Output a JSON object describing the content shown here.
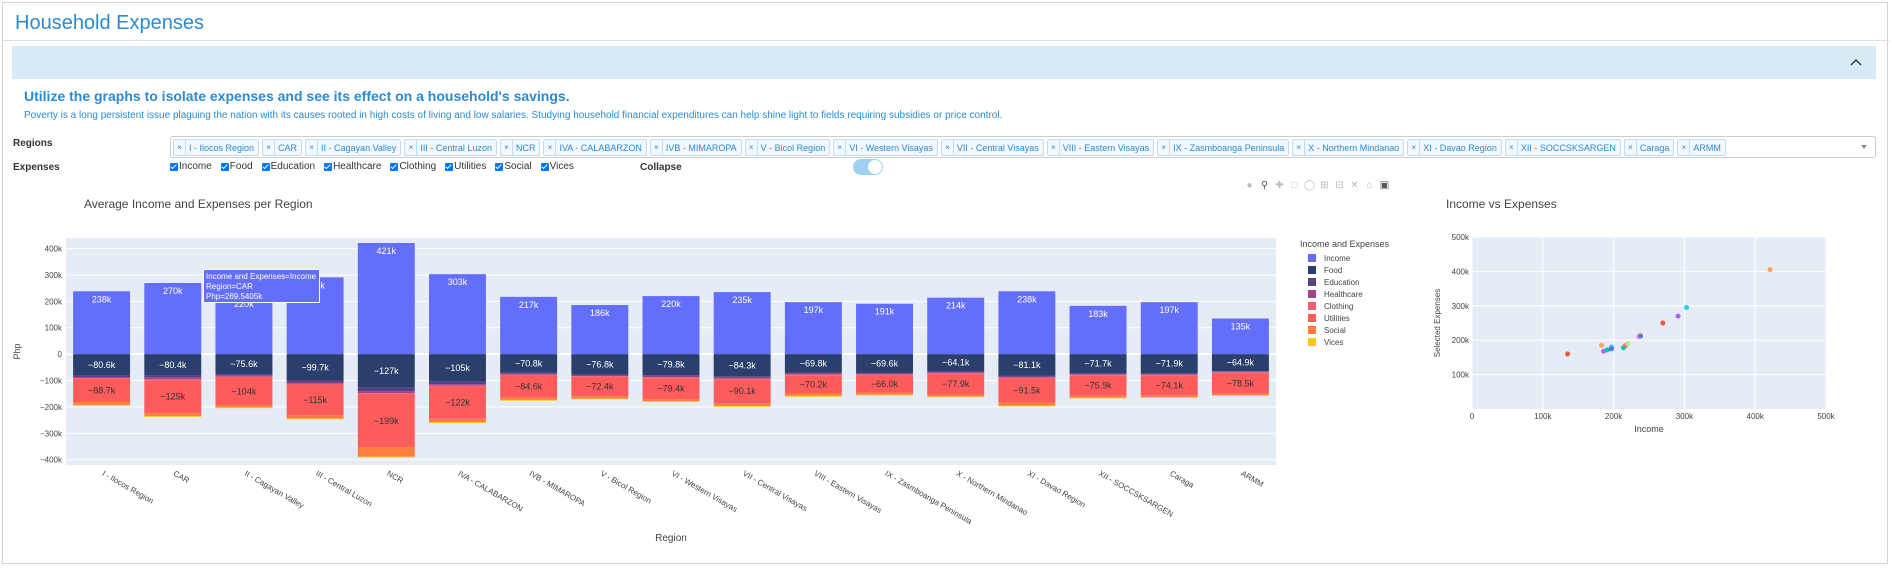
{
  "app": {
    "title": "Household Expenses"
  },
  "intro": {
    "heading": "Utilize the graphs to isolate expenses and see its effect on a household's savings.",
    "text": "Poverty is a long persistent issue plaguing the nation with its causes rooted in high costs of living and low salaries. Studying household financial expenditures can help shine light to fields requiring subsidies or price control."
  },
  "controls": {
    "regions_label": "Regions",
    "expenses_label": "Expenses",
    "collapse_label": "Collapse",
    "collapse_on": true,
    "regions": [
      "I - Ilocos Region",
      "CAR",
      "II - Cagayan Valley",
      "III - Central Luzon",
      "NCR",
      "IVA - CALABARZON",
      "IVB - MIMAROPA",
      "V - Bicol Region",
      "VI - Western Visayas",
      "VII - Central Visayas",
      "VIII - Eastern Visayas",
      "IX - Zasmboanga Peninsula",
      "X - Northern Mindanao",
      "XI - Davao Region",
      "XII - SOCCSKSARGEN",
      "Caraga",
      "ARMM"
    ],
    "remove_icon": "close-icon",
    "expenses": [
      {
        "label": "Income",
        "checked": true
      },
      {
        "label": "Food",
        "checked": true
      },
      {
        "label": "Education",
        "checked": true
      },
      {
        "label": "Healthcare",
        "checked": true
      },
      {
        "label": "Clothing",
        "checked": true
      },
      {
        "label": "Utilities",
        "checked": true
      },
      {
        "label": "Social",
        "checked": true
      },
      {
        "label": "Vices",
        "checked": true
      }
    ]
  },
  "modebar": [
    "camera-icon",
    "zoom-icon",
    "pan-icon",
    "box-select-icon",
    "lasso-icon",
    "zoom-in-icon",
    "zoom-out-icon",
    "autoscale-icon",
    "home-icon",
    "plotly-logo-icon"
  ],
  "colors": {
    "Income": "#636efa",
    "Food": "#2a3f6b",
    "Education": "#5b3f86",
    "Healthcare": "#a0458c",
    "Clothing": "#f25d76",
    "Utilities": "#fe5c5c",
    "Social": "#fd7f3c",
    "Vices": "#fdc21b"
  },
  "tooltip": {
    "line1": "Income and Expenses=Income",
    "line2": "Region=CAR",
    "line3": "Php=269.5405k"
  },
  "chart_data": [
    {
      "type": "bar",
      "title": "Average Income and Expenses per Region",
      "xlabel": "Region",
      "ylabel": "Php",
      "legend_title": "Income and Expenses",
      "legend_position": "right",
      "ylim": [
        -420000,
        440000
      ],
      "yticks": [
        400000,
        300000,
        200000,
        100000,
        0,
        -100000,
        -200000,
        -300000,
        -400000
      ],
      "ytick_labels": [
        "400k",
        "300k",
        "200k",
        "100k",
        "0",
        "−100k",
        "−200k",
        "−300k",
        "−400k"
      ],
      "categories": [
        "I - Ilocos Region",
        "CAR",
        "II - Cagayan Valley",
        "III - Central Luzon",
        "NCR",
        "IVA - CALABARZON",
        "IVB - MIMAROPA",
        "V - Bicol Region",
        "VI - Western Visayas",
        "VII - Central Visayas",
        "VIII - Eastern Visayas",
        "IX - Zasmboanga Peninsula",
        "X - Northern Mindanao",
        "XI - Davao Region",
        "XII - SOCCSKSARGEN",
        "Caraga",
        "ARMM"
      ],
      "series": [
        {
          "name": "Income",
          "values": [
            238000,
            269500,
            220000,
            291000,
            421000,
            303000,
            217000,
            186000,
            220000,
            235000,
            197000,
            191000,
            214000,
            238000,
            183000,
            197000,
            135000
          ],
          "labels": [
            "238k",
            "270k",
            "220k",
            "291k",
            "421k",
            "303k",
            "217k",
            "186k",
            "220k",
            "235k",
            "197k",
            "191k",
            "214k",
            "238k",
            "183k",
            "197k",
            "135k"
          ]
        },
        {
          "name": "Food",
          "values": [
            -80600,
            -80400,
            -75600,
            -99700,
            -127000,
            -105000,
            -70800,
            -76800,
            -79800,
            -84300,
            -69800,
            -69600,
            -64100,
            -81100,
            -71700,
            -71900,
            -64900
          ],
          "labels": [
            "−80.6k",
            "−80.4k",
            "−75.6k",
            "−99.7k",
            "−127k",
            "−105k",
            "−70.8k",
            "−76.8k",
            "−79.8k",
            "−84.3k",
            "−69.8k",
            "−69.6k",
            "−64.1k",
            "−81.1k",
            "−71.7k",
            "−71.9k",
            "−64.9k"
          ]
        },
        {
          "name": "Education",
          "values": [
            -6000,
            -9000,
            -6000,
            -8000,
            -14000,
            -9000,
            -4000,
            -4000,
            -5000,
            -5000,
            -4000,
            -4000,
            -5000,
            -5000,
            -4000,
            -4000,
            -2000
          ]
        },
        {
          "name": "Healthcare",
          "values": [
            -4000,
            -5000,
            -4000,
            -5000,
            -7000,
            -5000,
            -3000,
            -3000,
            -3000,
            -3000,
            -3000,
            -3000,
            -3000,
            -3000,
            -3000,
            -3000,
            -2000
          ]
        },
        {
          "name": "Clothing",
          "values": [
            -3000,
            -4000,
            -3000,
            -4000,
            -5000,
            -4000,
            -3000,
            -3000,
            -3000,
            -3000,
            -3000,
            -3000,
            -3000,
            -3000,
            -3000,
            -3000,
            -3000
          ]
        },
        {
          "name": "Utilities",
          "values": [
            -88700,
            -125000,
            -104000,
            -115000,
            -199000,
            -122000,
            -84600,
            -72400,
            -79400,
            -90100,
            -70200,
            -66000,
            -77900,
            -91500,
            -75900,
            -74100,
            -78500
          ],
          "labels": [
            "−88.7k",
            "−125k",
            "−104k",
            "−115k",
            "−199k",
            "−122k",
            "−84.6k",
            "−72.4k",
            "−79.4k",
            "−90.1k",
            "−70.2k",
            "−66.0k",
            "−77.9k",
            "−91.5k",
            "−75.9k",
            "−74.1k",
            "−78.5k"
          ]
        },
        {
          "name": "Social",
          "values": [
            -10000,
            -11000,
            -9000,
            -12000,
            -36000,
            -13000,
            -8000,
            -9000,
            -8000,
            -11000,
            -8000,
            -8000,
            -7000,
            -11000,
            -7000,
            -7000,
            -5000
          ]
        },
        {
          "name": "Vices",
          "values": [
            -3000,
            -3000,
            -3000,
            -3000,
            -3000,
            -3000,
            -3000,
            -3000,
            -3000,
            -3000,
            -3000,
            -3000,
            -3000,
            -3000,
            -3000,
            -3000,
            -3000
          ]
        }
      ]
    },
    {
      "type": "scatter",
      "title": "Income vs Expenses",
      "xlabel": "Income",
      "ylabel": "Selected Expenses",
      "xlim": [
        0,
        500000
      ],
      "ylim": [
        0,
        500000
      ],
      "xticks": [
        0,
        100000,
        200000,
        300000,
        400000,
        500000
      ],
      "xtick_labels": [
        "0",
        "100k",
        "200k",
        "300k",
        "400k",
        "500k"
      ],
      "yticks": [
        100000,
        200000,
        300000,
        400000,
        500000
      ],
      "ytick_labels": [
        "100k",
        "200k",
        "300k",
        "400k",
        "500k"
      ],
      "points": [
        {
          "x": 135000,
          "y": 160000,
          "color": "#ef553b"
        },
        {
          "x": 183000,
          "y": 185000,
          "color": "#ffa15a"
        },
        {
          "x": 186000,
          "y": 168000,
          "color": "#ab63fa"
        },
        {
          "x": 191000,
          "y": 172000,
          "color": "#00cc96"
        },
        {
          "x": 197000,
          "y": 180000,
          "color": "#19d3f3"
        },
        {
          "x": 197000,
          "y": 175000,
          "color": "#636efa"
        },
        {
          "x": 214000,
          "y": 178000,
          "color": "#00cc96"
        },
        {
          "x": 217000,
          "y": 185000,
          "color": "#ff6692"
        },
        {
          "x": 220000,
          "y": 190000,
          "color": "#b6e880"
        },
        {
          "x": 235000,
          "y": 210000,
          "color": "#ff97ff"
        },
        {
          "x": 238000,
          "y": 215000,
          "color": "#fecb52"
        },
        {
          "x": 238000,
          "y": 212000,
          "color": "#636efa"
        },
        {
          "x": 269500,
          "y": 250000,
          "color": "#ef553b"
        },
        {
          "x": 291000,
          "y": 270000,
          "color": "#ab63fa"
        },
        {
          "x": 303000,
          "y": 295000,
          "color": "#19d3f3"
        },
        {
          "x": 421000,
          "y": 405000,
          "color": "#ffa15a"
        }
      ]
    }
  ]
}
